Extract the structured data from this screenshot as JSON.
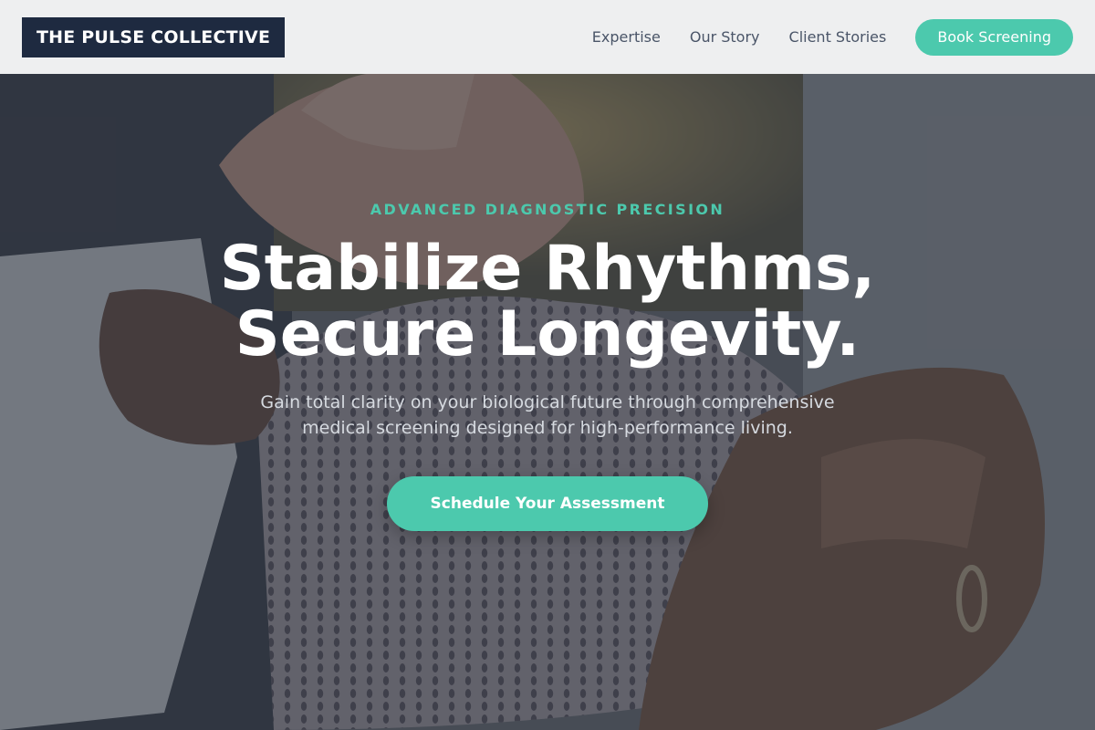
{
  "header": {
    "brand": "THE PULSE COLLECTIVE",
    "nav": [
      {
        "label": "Expertise"
      },
      {
        "label": "Our Story"
      },
      {
        "label": "Client Stories"
      }
    ],
    "cta_label": "Book Screening"
  },
  "hero": {
    "eyebrow": "ADVANCED DIAGNOSTIC PRECISION",
    "headline_line1": "Stabilize Rhythms,",
    "headline_line2": "Secure Longevity.",
    "subtext": "Gain total clarity on your biological future through comprehensive medical screening designed for high-performance living.",
    "cta_label": "Schedule Your Assessment",
    "background_image": "doctor-hands-examining-patient-photo"
  },
  "colors": {
    "accent": "#4cc9ad",
    "brand_dark": "#1e2a40",
    "header_bg": "#eeeff0",
    "nav_text": "#4a5568"
  }
}
